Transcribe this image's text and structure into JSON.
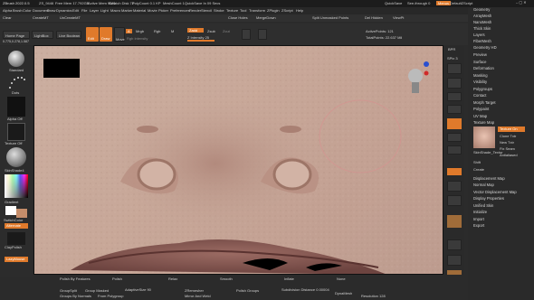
{
  "titlebar": {
    "app": "ZBrush 2022.0.5",
    "file": "ZS_9446",
    "mem": "Free Mem 17.792GB",
    "mem2": "Active Mem 9081",
    "scratch": "Scratch Disk 72",
    "poly": "PolyCount 0.1 KP",
    "mesh": "MeshCount 1",
    "quicksave": "QuickSave In 09 Secs",
    "qs_btn": "QuickSave",
    "seethrough": "See-through 0",
    "menus": "Menus",
    "script": "DefaultZScript"
  },
  "menubar": [
    "Alpha",
    "Brush",
    "Color",
    "Document",
    "Draw",
    "Dynamics",
    "Edit",
    "File",
    "Layer",
    "Light",
    "Macro",
    "Marker",
    "Material",
    "Movie",
    "Picker",
    "Preferences",
    "Render",
    "Stencil",
    "Stroke",
    "Texture",
    "Tool",
    "Transform",
    "ZPlugin",
    "ZScript",
    "Help"
  ],
  "toolbar": [
    "Clear",
    "CreateMT",
    "UnCreateMT",
    "Close Holes",
    "MergeDown",
    "Split Unmasked Points",
    "Del Hidden",
    "ViewPt"
  ],
  "shelf": {
    "home": "Home Page",
    "lightbox": "LightBox",
    "liveboolean": "Live Boolean",
    "edit": "Edit",
    "draw": "Draw",
    "move": "Move",
    "scale": "Scale",
    "rotate": "Rotate",
    "a": "A",
    "mrgb": "Mrgb",
    "rgb": "Rgb",
    "m": "M",
    "zadd": "Zadd",
    "zsub": "Zsub",
    "zcut": "Zcut",
    "rgb_int": "Rgb Intensity",
    "z_int": "Z Intensity 25",
    "focal": "Focal Shift 0",
    "draw_size": "Draw Size 64",
    "active_points": "ActivePoints: 121",
    "total_points": "TotalPoints: 22.637 Mil"
  },
  "coords": "0.775,0.278,1.587",
  "left": {
    "standard": "Standard",
    "dots": "Dots",
    "alpha_off": "Alpha Off",
    "texture": "Texture Off",
    "material": "SkinShade4",
    "gradient": "Gradient",
    "switchcolor": "SwitchColor",
    "alternate": "Alternate",
    "claypolish": "ClayPolish",
    "lazymouse": "LazyMouse"
  },
  "bottom": {
    "polish_feat": "Polish By Features",
    "polish": "Polish",
    "relax": "Relax",
    "smooth": "Smooth",
    "inflate": "Inflate",
    "none": "None",
    "groupsplit": "GroupSplit",
    "groupmasked": "Group Masked",
    "adaptive": "AdaptiveSize 90",
    "dynamesh": "DynaMesh",
    "resolution": "Resolution 128",
    "zremesher": "ZRemesher",
    "mirror": "Mirror And Weld",
    "polish_groups": "Polish Groups",
    "project": "Project",
    "subdiv": "Subdivision Distance 0.00004",
    "groups_normals": "Groups By Normals",
    "from_polygroup": "From Polygroup",
    "double": "Double",
    "detect": "Detect Edges"
  },
  "rightmenu": [
    "Geometry",
    "ArrayMesh",
    "NanoMesh",
    "Thick Skin",
    "Layers",
    "FiberMesh",
    "Geometry HD",
    "Preview",
    "Surface",
    "Deformation",
    "Masking",
    "Visibility",
    "Polygroups",
    "Contact",
    "Morph Target",
    "Polypaint",
    "UV Map",
    "Texture Map",
    "",
    "",
    "",
    "",
    "",
    "",
    "",
    "",
    "",
    "",
    "Displacement Map",
    "Normal Map",
    "Vector Displacement Map",
    "Display Properties",
    "Unified Skin",
    "Initialize",
    "Import",
    "Export"
  ],
  "texmap": {
    "texture_on": "Texture On",
    "clone": "Clone Txtr",
    "new": "New Txtr",
    "fix": "Fix Seam",
    "label": "SkinShade_Textur",
    "antialias": "Antialiased",
    "create": "Create",
    "shift": "Shift"
  },
  "rightshelf": [
    "BPR",
    "SPix 3",
    "Scroll",
    "Zoom",
    "Actual",
    "AAHalf",
    "Persp",
    "Floor",
    "Local",
    "Frame",
    "Move",
    "Zoom3D",
    "Rotate",
    "Transp",
    "Ghost",
    "Solo",
    "Xpose"
  ],
  "colors": {
    "accent": "#e07a2b",
    "bg": "#2b2b2b"
  }
}
